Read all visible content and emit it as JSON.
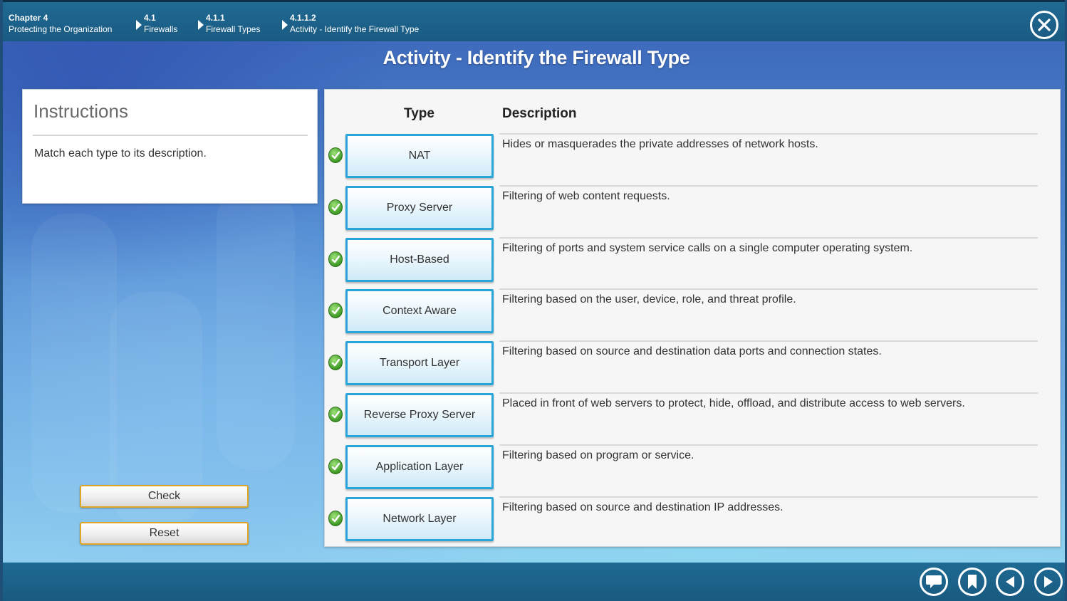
{
  "breadcrumb": [
    {
      "num": "Chapter 4",
      "label": "Protecting the Organization"
    },
    {
      "num": "4.1",
      "label": "Firewalls"
    },
    {
      "num": "4.1.1",
      "label": "Firewall Types"
    },
    {
      "num": "4.1.1.2",
      "label": "Activity - Identify the Firewall Type"
    }
  ],
  "page_title": "Activity - Identify the Firewall Type",
  "instructions": {
    "title": "Instructions",
    "text": "Match each type to its description."
  },
  "buttons": {
    "check": "Check",
    "reset": "Reset"
  },
  "table": {
    "type_header": "Type",
    "description_header": "Description",
    "rows": [
      {
        "type": "NAT",
        "description": "Hides or masquerades the private addresses of network hosts.",
        "correct": true
      },
      {
        "type": "Proxy Server",
        "description": "Filtering of web content requests.",
        "correct": true
      },
      {
        "type": "Host-Based",
        "description": "Filtering of ports and system service calls on a single computer operating system.",
        "correct": true
      },
      {
        "type": "Context Aware",
        "description": "Filtering based on the user, device, role, and threat profile.",
        "correct": true
      },
      {
        "type": "Transport Layer",
        "description": "Filtering based on source and destination data ports and connection states.",
        "correct": true
      },
      {
        "type": "Reverse Proxy Server",
        "description": "Placed in front of web servers to protect, hide, offload, and distribute access to web servers.",
        "correct": true
      },
      {
        "type": "Application Layer",
        "description": "Filtering based on program or service.",
        "correct": true
      },
      {
        "type": "Network Layer",
        "description": "Filtering based on source and destination IP addresses.",
        "correct": true
      }
    ]
  },
  "icons": {
    "close": "close-icon",
    "footer": [
      "comment-icon",
      "bookmark-icon",
      "previous-icon",
      "next-icon"
    ],
    "row_status": "checkmark-icon"
  },
  "colors": {
    "header_bar": "#1a5a82",
    "type_border": "#2aa5d8",
    "check_green": "#3f9a26",
    "button_border": "#e0a627"
  }
}
